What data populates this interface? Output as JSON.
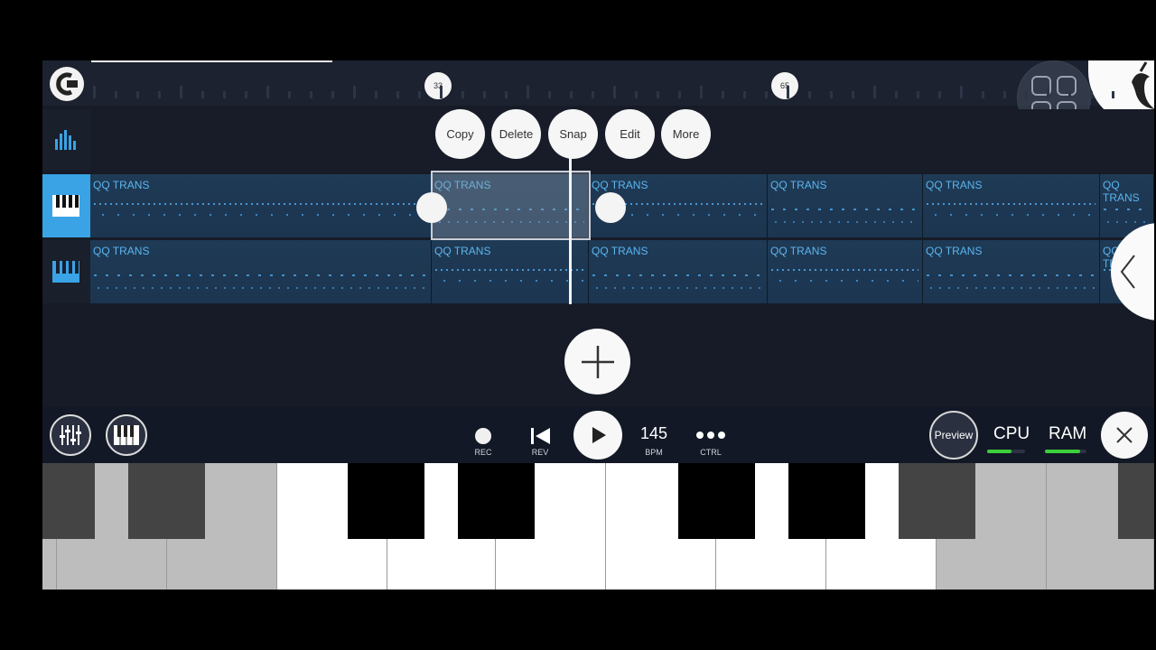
{
  "timeline": {
    "markers": [
      "33",
      "65"
    ]
  },
  "context_menu": {
    "copy": "Copy",
    "delete": "Delete",
    "snap": "Snap",
    "edit": "Edit",
    "more": "More"
  },
  "tracks": [
    {
      "patterns": [
        "QQ TRANS",
        "QQ TRANS",
        "QQ TRANS",
        "QQ TRANS",
        "QQ TRANS",
        "QQ TRANS"
      ]
    },
    {
      "patterns": [
        "QQ TRANS",
        "QQ TRANS",
        "QQ TRANS",
        "QQ TRANS",
        "QQ TRANS",
        "QQ TRANS"
      ]
    }
  ],
  "transport": {
    "rec_label": "REC",
    "rev_label": "REV",
    "bpm_value": "145",
    "bpm_label": "BPM",
    "ctrl_label": "CTRL",
    "preview_label": "Preview",
    "cpu_label": "CPU",
    "ram_label": "RAM"
  },
  "meters": {
    "cpu_level": 0.65,
    "ram_level": 0.85
  },
  "colors": {
    "accent": "#3aa3e6",
    "pattern_text": "#5bb5ef",
    "meter_green": "#3ad13a",
    "background": "#161b27"
  },
  "icons": {
    "app": "fl-logo-icon",
    "grid": "grid-icon",
    "back": "chevron-left-icon",
    "close": "close-icon",
    "add": "plus-icon"
  }
}
